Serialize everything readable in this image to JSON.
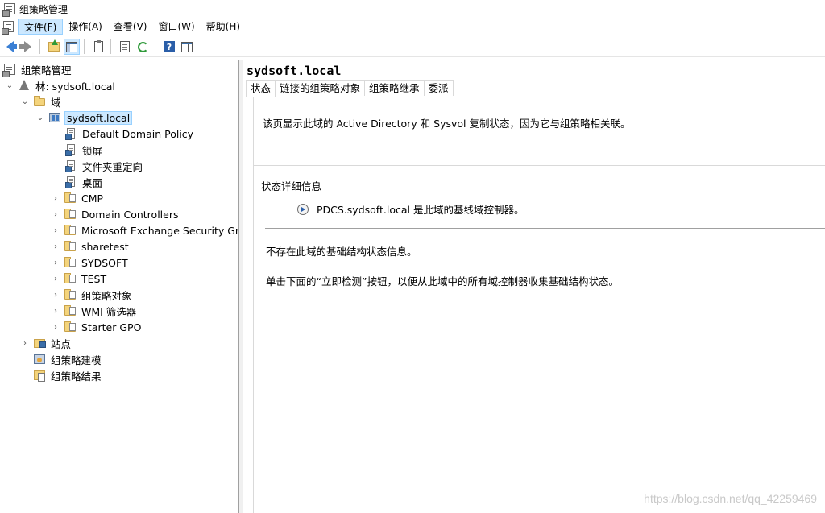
{
  "window": {
    "title": "组策略管理"
  },
  "menu": {
    "items": [
      {
        "label": "文件(F)",
        "active": true
      },
      {
        "label": "操作(A)"
      },
      {
        "label": "查看(V)"
      },
      {
        "label": "窗口(W)"
      },
      {
        "label": "帮助(H)"
      }
    ]
  },
  "toolbar": {
    "icons": [
      "back-arrow-icon",
      "forward-arrow-icon",
      "up-folder-icon",
      "show-tree-icon",
      "clipboard-icon",
      "export-list-icon",
      "refresh-icon",
      "help-icon",
      "panel-icon"
    ]
  },
  "tree": {
    "root": "组策略管理",
    "forest": "林: sydsoft.local",
    "domains_folder": "域",
    "domain": "sydsoft.local",
    "children": [
      "Default Domain Policy",
      "锁屏",
      "文件夹重定向",
      "桌面",
      "CMP",
      "Domain Controllers",
      "Microsoft Exchange Security Grou",
      "sharetest",
      "SYDSOFT",
      "TEST",
      "组策略对象",
      "WMI 筛选器",
      "Starter GPO"
    ],
    "sites": "站点",
    "modeling": "组策略建模",
    "results": "组策略结果"
  },
  "detail": {
    "title": "sydsoft.local",
    "tabs": [
      "状态",
      "链接的组策略对象",
      "组策略继承",
      "委派"
    ],
    "description": "该页显示此域的 Active Directory 和 Sysvol 复制状态，因为它与组策略相关联。",
    "group_label": "状态详细信息",
    "baseline": "PDCS.sydsoft.local 是此域的基线域控制器。",
    "info1": "不存在此域的基础结构状态信息。",
    "info2": "单击下面的“立即检测”按钮，以便从此域中的所有域控制器收集基础结构状态。"
  },
  "watermark": "https://blog.csdn.net/qq_42259469"
}
